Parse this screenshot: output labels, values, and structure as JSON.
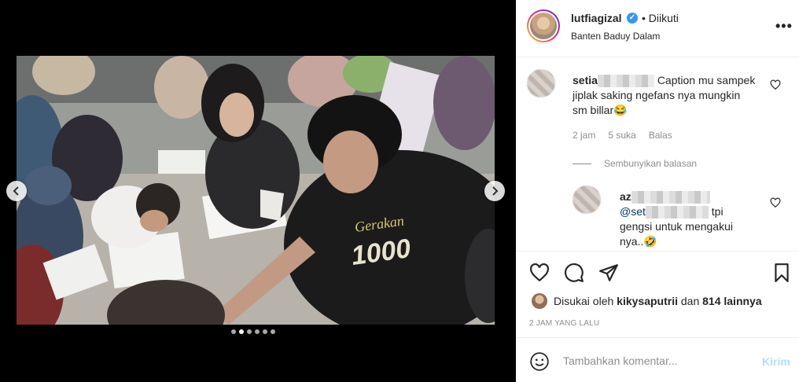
{
  "post": {
    "username": "lutfiagizal",
    "follow_separator": "•",
    "follow_status": "Diikuti",
    "location": "Banten Baduy Dalam",
    "more_label": "•••"
  },
  "media": {
    "shirt_text_top": "Gerakan",
    "shirt_text_main": "1000",
    "slide_count": 6,
    "active_slide": 2
  },
  "comments": [
    {
      "username": "setia",
      "text_line1": "Caption mu sampek",
      "text_line2": "jiplak saking ngefans nya mungkin",
      "text_line3": "sm billar😂",
      "time": "2 jam",
      "likes": "5 suka",
      "reply_label": "Balas"
    }
  ],
  "hide_replies_label": "Sembunyikan balasan",
  "reply": {
    "username": "az",
    "mention": "@set",
    "text_line1_suffix": "tpi",
    "text_line2": "gengsi untuk mengakui",
    "text_line3": "nya..🤣"
  },
  "likes": {
    "prefix": "Disukai oleh",
    "liker": "kikysaputrii",
    "conjunction": "dan",
    "others": "814 lainnya"
  },
  "timestamp": "2 JAM YANG LALU",
  "comment_box": {
    "placeholder": "Tambahkan komentar...",
    "post_label": "Kirim"
  },
  "colors": {
    "link_blue": "#00376b",
    "verified_blue": "#3897f0",
    "muted_text": "#8e8e8e",
    "post_button_disabled": "#b2dffc"
  }
}
